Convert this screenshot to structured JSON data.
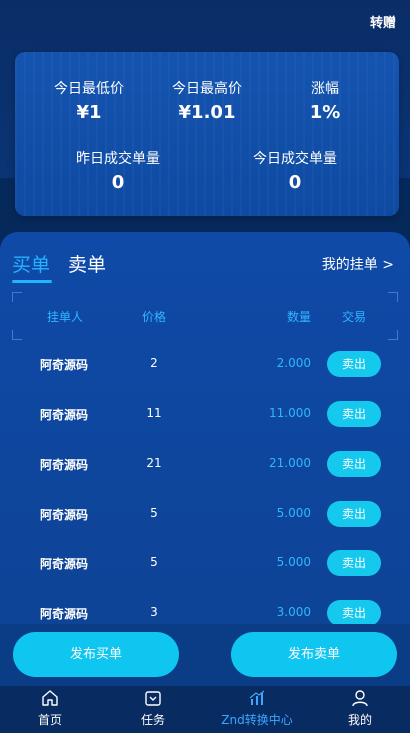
{
  "header": {
    "transfer_label": "转赠"
  },
  "stats": {
    "lowest_label": "今日最低价",
    "lowest_value": "¥1",
    "highest_label": "今日最高价",
    "highest_value": "¥1.01",
    "change_label": "涨幅",
    "change_value": "1%",
    "yesterday_volume_label": "昨日成交单量",
    "yesterday_volume_value": "0",
    "today_volume_label": "今日成交单量",
    "today_volume_value": "0"
  },
  "market": {
    "tabs": [
      {
        "label": "买单",
        "active": true
      },
      {
        "label": "卖单",
        "active": false
      }
    ],
    "my_orders_label": "我的挂单 >",
    "columns": [
      "挂单人",
      "价格",
      "数量",
      "交易"
    ],
    "rows": [
      {
        "user": "阿奇源码",
        "price": "2",
        "qty": "2.000",
        "action": "卖出"
      },
      {
        "user": "阿奇源码",
        "price": "11",
        "qty": "11.000",
        "action": "卖出"
      },
      {
        "user": "阿奇源码",
        "price": "21",
        "qty": "21.000",
        "action": "卖出"
      },
      {
        "user": "阿奇源码",
        "price": "5",
        "qty": "5.000",
        "action": "卖出"
      },
      {
        "user": "阿奇源码",
        "price": "5",
        "qty": "5.000",
        "action": "卖出"
      },
      {
        "user": "阿奇源码",
        "price": "3",
        "qty": "3.000",
        "action": "卖出"
      }
    ]
  },
  "actions": {
    "publish_buy": "发布买单",
    "publish_sell": "发布卖单"
  },
  "nav": {
    "items": [
      {
        "label": "首页",
        "icon": "home-icon"
      },
      {
        "label": "任务",
        "icon": "task-icon"
      },
      {
        "label": "Znd转换中心",
        "icon": "chart-icon",
        "active": true
      },
      {
        "label": "我的",
        "icon": "user-icon"
      }
    ]
  },
  "colors": {
    "accent": "#23b3ff",
    "button": "#14c8ee",
    "background": "#06295c"
  }
}
